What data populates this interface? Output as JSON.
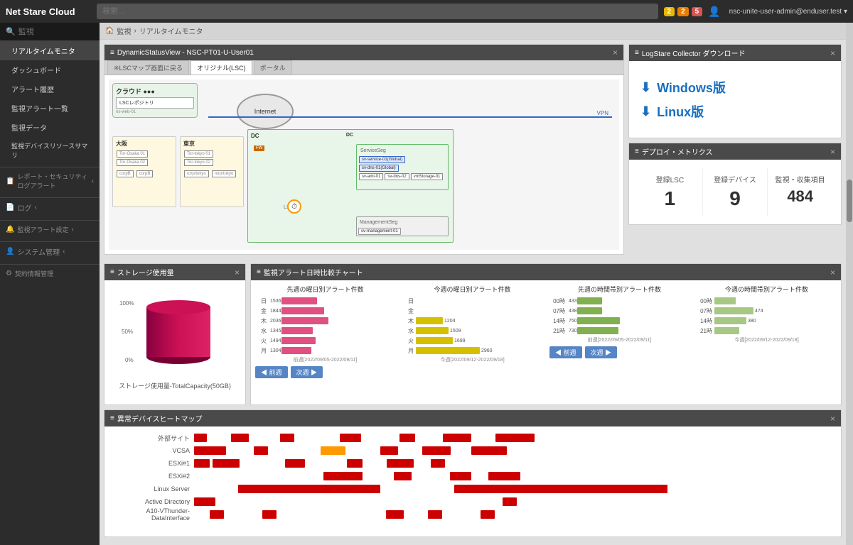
{
  "app": {
    "title": "Net Stare Cloud"
  },
  "header": {
    "search_placeholder": "検索",
    "notifications": [
      {
        "label": "2",
        "color": "yellow"
      },
      {
        "label": "2",
        "color": "orange"
      },
      {
        "label": "5",
        "color": "red"
      }
    ],
    "user": "nsc-unite-user-admin@enduser.test ▾"
  },
  "sidebar": {
    "search_label": "監視",
    "items": [
      {
        "label": "リアルタイムモニタ",
        "active": true
      },
      {
        "label": "ダッシュボード"
      },
      {
        "label": "アラート履歴"
      },
      {
        "label": "監視アラート一覧"
      },
      {
        "label": "監視データ"
      },
      {
        "label": "監視デバイスリソースサマリ"
      },
      {
        "label": "レポート・セキュリティログアラート",
        "section": true,
        "icon": "📋"
      },
      {
        "label": "ログ",
        "section": true,
        "icon": "📄"
      },
      {
        "label": "監視アラート設定",
        "section": true,
        "icon": "🔔"
      },
      {
        "label": "システム管理",
        "section": true,
        "icon": "👤"
      },
      {
        "label": "契約情報管理",
        "section": true,
        "icon": "⚙"
      }
    ]
  },
  "breadcrumb": {
    "home": "監視",
    "separator": "›",
    "current": "リアルタイムモニタ"
  },
  "dsv_panel": {
    "title": "DynamicStatusView - NSC-PT01-U-User01",
    "tabs": [
      {
        "label": "※LSCマップ画面に戻る"
      },
      {
        "label": "オリジナル(LSC)"
      },
      {
        "label": "ポータル"
      }
    ],
    "network": {
      "cloud_label": "クラウド",
      "internet_label": "Internet",
      "vpn_label": "VPN",
      "osaka_label": "大阪",
      "tokyo_label": "東京",
      "dc_label": "DC",
      "service_seg_label": "ServiceSeg",
      "management_seg_label": "ManagementSeg"
    }
  },
  "download_panel": {
    "title": "LogStare Collector ダウンロード",
    "windows_label": "Windows版",
    "linux_label": "Linux版"
  },
  "deploy_metrics": {
    "title": "デプロイ・メトリクス",
    "items": [
      {
        "label": "登録LSC",
        "value": "1"
      },
      {
        "label": "登録デバイス",
        "value": "9"
      },
      {
        "label": "監視・収集項目",
        "value": "484"
      }
    ]
  },
  "storage_panel": {
    "title": "ストレージ使用量",
    "labels": [
      "100%",
      "50%",
      "0%"
    ],
    "caption": "ストレージ使用量-TotalCapacity(50GB)"
  },
  "alert_chart": {
    "title": "監視アラート日時比較チャート",
    "sections": [
      {
        "title": "先週の曜日別アラート件数",
        "days": [
          "日",
          "金",
          "木",
          "水",
          "火",
          "月"
        ],
        "values": [
          1536,
          1844,
          2036,
          1345,
          1494,
          1304
        ],
        "period": "前週[2022/09/05-2022/09/11]"
      },
      {
        "title": "今週の曜日別アラート件数",
        "days": [
          "",
          "",
          "",
          "1204",
          "1509",
          "1699",
          "2960"
        ],
        "period": "今週[2022/09/12-2022/09/18]"
      },
      {
        "title": "先週の時間帯別アラート件数",
        "hours": [
          "00時",
          "07時",
          "14時",
          "21時"
        ],
        "values": [
          433,
          438,
          750,
          730
        ],
        "period": "前週[2022/09/05-2022/09/11]"
      },
      {
        "title": "今週の時間帯別アラート件数",
        "period": "今週[2022/09/12-2022/09/18]"
      }
    ],
    "prev_btn": "◀ 前週",
    "next_btn": "次週 ▶"
  },
  "heatmap": {
    "title": "異常デバイスヒートマップ",
    "rows": [
      {
        "label": "外部サイト",
        "cells": [
          3,
          0,
          0,
          0,
          2,
          0,
          0,
          0,
          1,
          0,
          0,
          2,
          0,
          0,
          1,
          0,
          0,
          2,
          0,
          0,
          1,
          0
        ]
      },
      {
        "label": "VCSA",
        "cells": [
          2,
          0,
          0,
          1,
          0,
          0,
          0,
          3,
          0,
          0,
          "o",
          0,
          0,
          0,
          1,
          0,
          0,
          2,
          0,
          1,
          0,
          0
        ]
      },
      {
        "label": "ESXi#1",
        "cells": [
          1,
          2,
          0,
          0,
          0,
          0,
          0,
          1,
          0,
          0,
          0,
          2,
          0,
          0,
          0,
          1,
          0,
          2,
          0,
          0,
          1,
          0
        ]
      },
      {
        "label": "ESXi#2",
        "cells": [
          0,
          0,
          0,
          0,
          0,
          0,
          0,
          0,
          0,
          0,
          0,
          0,
          1,
          2,
          0,
          0,
          1,
          0,
          0,
          0,
          1,
          2
        ]
      },
      {
        "label": "Linux Server",
        "cells": [
          0,
          0,
          0,
          3,
          4,
          3,
          2,
          0,
          0,
          0,
          0,
          0,
          0,
          0,
          0,
          0,
          0,
          2,
          3,
          4,
          3,
          2
        ]
      },
      {
        "label": "Active Directory",
        "cells": [
          1,
          0,
          0,
          0,
          0,
          0,
          0,
          0,
          0,
          0,
          0,
          0,
          0,
          0,
          0,
          0,
          0,
          0,
          2,
          0,
          0,
          0
        ]
      },
      {
        "label": "A10-VThunder-DataInterface",
        "cells": [
          0,
          1,
          0,
          0,
          0,
          1,
          0,
          0,
          0,
          0,
          0,
          0,
          0,
          2,
          0,
          1,
          0,
          0,
          0,
          1,
          0,
          0
        ]
      }
    ]
  }
}
